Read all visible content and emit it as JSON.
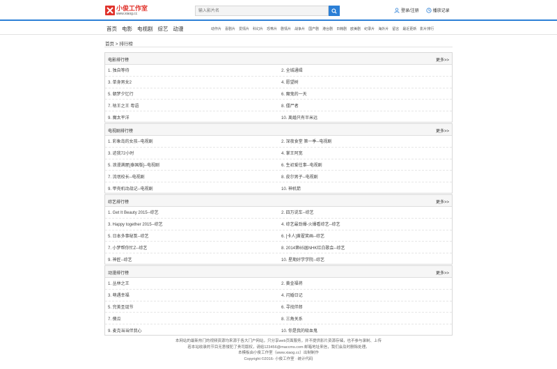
{
  "header": {
    "logo_title": "小俊工作室",
    "logo_url": "www.xiaog.cc",
    "search_placeholder": "输入影片名",
    "login_label": "登录/注册",
    "history_label": "播放记录"
  },
  "nav": {
    "main": [
      "首页",
      "电影",
      "电视剧",
      "综艺",
      "动漫"
    ],
    "sub": [
      "动作片",
      "喜剧片",
      "爱情片",
      "科幻片",
      "恐怖片",
      "剧情片",
      "战争片",
      "国产剧",
      "港台剧",
      "日韩剧",
      "欧美剧",
      "纪录片",
      "海外片",
      "留言",
      "最近更新",
      "影片排行"
    ]
  },
  "breadcrumb": "首页 > 排行榜",
  "panels": [
    {
      "title": "电影排行榜",
      "more": "更多>>",
      "items": [
        "1. 独自等待",
        "2. 全城通缉",
        "3. 单身男女2",
        "4. 愿望树",
        "5. 朝梦夕忆行",
        "6. 魔鬼的一天",
        "7. 枯王之王 粤语",
        "8. 僵尸者",
        "9. 魔太平洋",
        "10. 离婚只有半米远"
      ]
    },
    {
      "title": "电视剧排行榜",
      "more": "更多>>",
      "items": [
        "1. 彩象岛的女孩--电视剧",
        "2. 深夜食堂 第一季--电视剧",
        "3. 迹我72小时",
        "4. 掌王阿宽",
        "5. 浪漫满屋[泰国版]--电视剧",
        "6. 生初爱往事--电视剧",
        "7. 流氓校长--电视剧",
        "8. 皮尔男子--电视剧",
        "9. 甲壳机动战记--电视剧",
        "10. 神机箭"
      ]
    },
    {
      "title": "综艺排行榜",
      "more": "更多>>",
      "items": [
        "1. Get It Beauty 2015--综艺",
        "2. 四万说车--综艺",
        "3. Happy together 2015--综艺",
        "4. 综艺最劲爆-火爆看综艺--综艺",
        "5. 日本多事秘笈--综艺",
        "6. [卡人]黄翟笑画--综艺",
        "7. 小梦帮你忙Z--综艺",
        "8. 2014第65届NHK红白歌会--综艺",
        "9. 神匠--综艺",
        "10. 星期好学学院--综艺"
      ]
    },
    {
      "title": "动漫排行榜",
      "more": "更多>>",
      "items": [
        "1. 丛林之王",
        "2. 黄金福将",
        "3. 萌遇幸福",
        "4. 闪婚日记",
        "5. 完美圣诞节",
        "6. 寻找伴郎",
        "7. 傻瓜",
        "8. 三角关系",
        "9. 麦克当当伴我心",
        "10. 你是我的吸血鬼"
      ]
    }
  ],
  "footer": [
    "本网站的最新热门的视频资源均来源于各大门户网站，只分享web页面服务，并不提供影片资源存储，也不参与录制、上传",
    "若本站收录的节目无意侵犯了贵司版权，请给123456@maccms.com 邮箱地址来信，我们会及时删除处理。",
    "本模板由小俊工作室（www.xiaog.cc）出制制作",
    "Copyright ©2016- 小俊工作室 · 统计代码"
  ]
}
